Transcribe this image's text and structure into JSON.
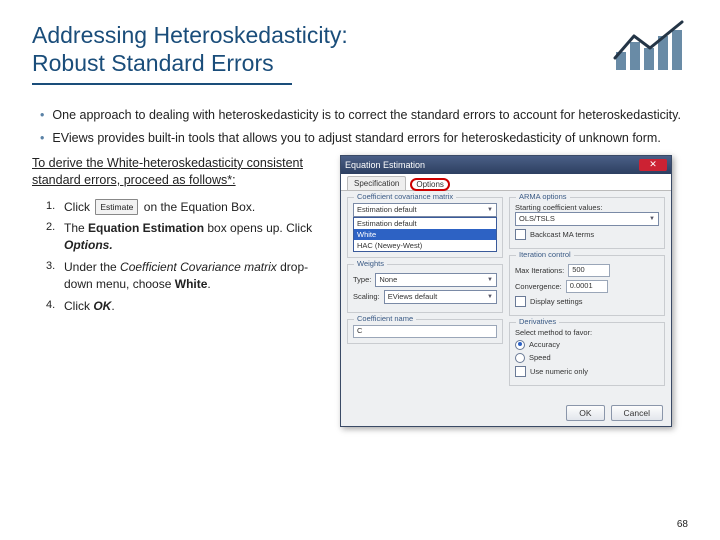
{
  "title_line1": "Addressing Heteroskedasticity:",
  "title_line2": "Robust Standard Errors",
  "bullets": [
    "One approach to dealing with heteroskedasticity is to correct the standard errors to account for heteroskedasticity.",
    "EViews provides built-in tools that allows you to adjust standard errors for heteroskedasticity of unknown form."
  ],
  "subhead": "To derive the White-heteroskedasticity consistent standard errors, proceed as follows*:",
  "steps": {
    "s1_pre": "Click",
    "s1_btn": "Estimate",
    "s1_post": "on the Equation Box.",
    "s2_pre": "The ",
    "s2_bold": "Equation Estimation",
    "s2_post": " box opens up. Click ",
    "s2_bi": "Options.",
    "s3_pre": "Under the ",
    "s3_it": "Coefficient Covariance matrix",
    "s3_mid": " drop-down menu, choose ",
    "s3_bold": "White",
    "s3_end": ".",
    "s4_pre": "Click ",
    "s4_bi": "OK",
    "s4_end": "."
  },
  "dialog": {
    "title": "Equation Estimation",
    "tabs": [
      "Specification",
      "Options"
    ],
    "cov": {
      "legend": "Coefficient covariance matrix",
      "selected": "Estimation default",
      "options": [
        "Estimation default",
        "White",
        "HAC (Newey-West)"
      ]
    },
    "weights": {
      "legend": "Weights",
      "type_lbl": "Type:",
      "type_val": "None",
      "scaling_lbl": "Scaling:",
      "scaling_val": "EViews default"
    },
    "coefname": {
      "legend": "Coefficient name",
      "value": "C"
    },
    "arma": {
      "legend": "ARMA options",
      "start_lbl": "Starting coefficient values:",
      "start_val": "OLS/TSLS",
      "backcast": "Backcast MA terms"
    },
    "iter": {
      "legend": "Iteration control",
      "max_lbl": "Max Iterations:",
      "max_val": "500",
      "conv_lbl": "Convergence:",
      "conv_val": "0.0001",
      "disp": "Display settings"
    },
    "deriv": {
      "legend": "Derivatives",
      "note": "Select method to favor:",
      "opts": [
        "Accuracy",
        "Speed"
      ],
      "fast": "Use numeric only"
    },
    "ok": "OK",
    "cancel": "Cancel"
  },
  "page": "68"
}
